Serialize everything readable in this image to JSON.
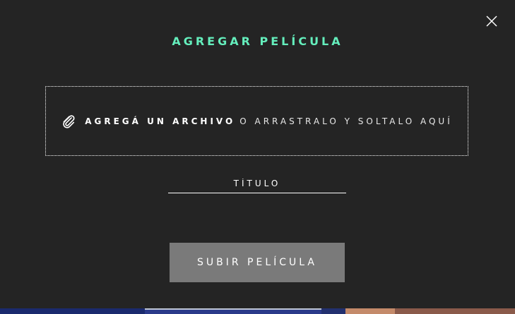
{
  "modal": {
    "title": "AGREGAR PELÍCULA",
    "close_icon": "close-icon"
  },
  "dropzone": {
    "icon": "paperclip-icon",
    "strong_text": "AGREGÁ UN ARCHIVO",
    "rest_text": "O ARRASTRALO Y SOLTALO AQUÍ"
  },
  "title_field": {
    "placeholder": "TÍTULO",
    "value": ""
  },
  "submit": {
    "label": "SUBIR PELÍCULA"
  },
  "colors": {
    "background": "#242424",
    "accent": "#64eebc",
    "button_bg": "#7a7a7a",
    "text": "#ffffff"
  }
}
